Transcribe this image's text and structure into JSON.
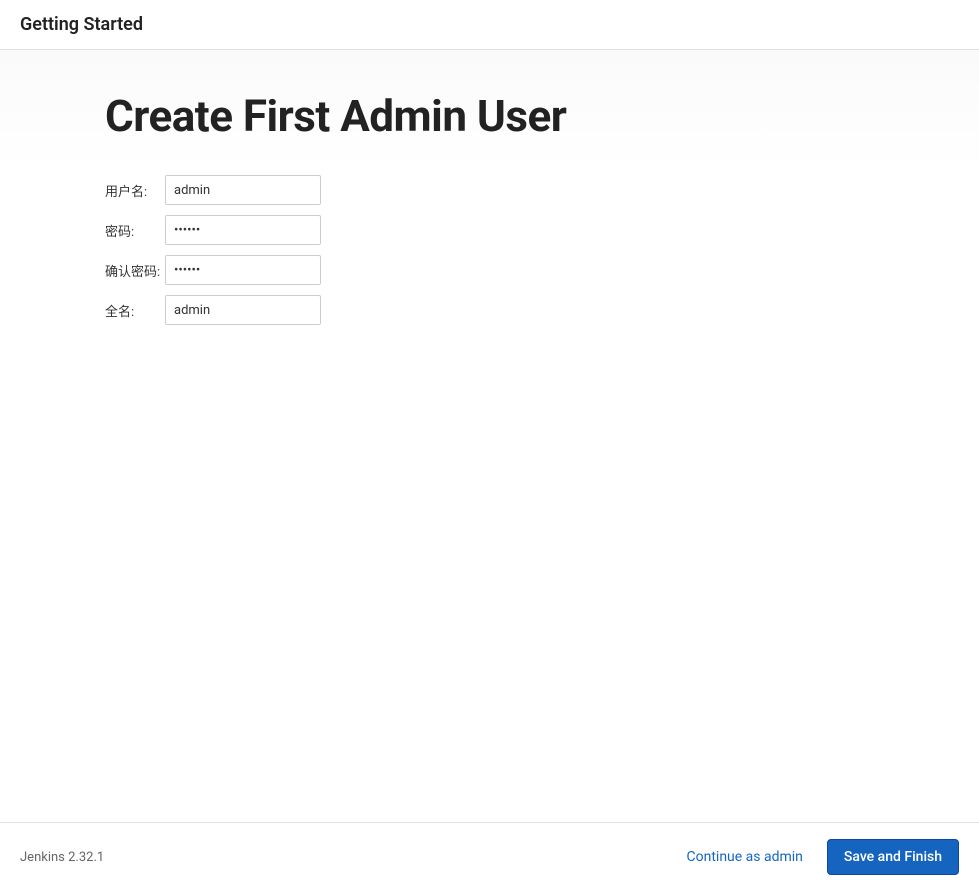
{
  "header": {
    "title": "Getting Started"
  },
  "main": {
    "title": "Create First Admin User",
    "fields": {
      "username": {
        "label": "用户名:",
        "value": "admin"
      },
      "password": {
        "label": "密码:",
        "value": "••••••"
      },
      "confirm_password": {
        "label": "确认密码:",
        "value": "••••••"
      },
      "fullname": {
        "label": "全名:",
        "value": "admin"
      }
    }
  },
  "footer": {
    "version": "Jenkins 2.32.1",
    "continue_as_admin": "Continue as admin",
    "save_and_finish": "Save and Finish"
  }
}
